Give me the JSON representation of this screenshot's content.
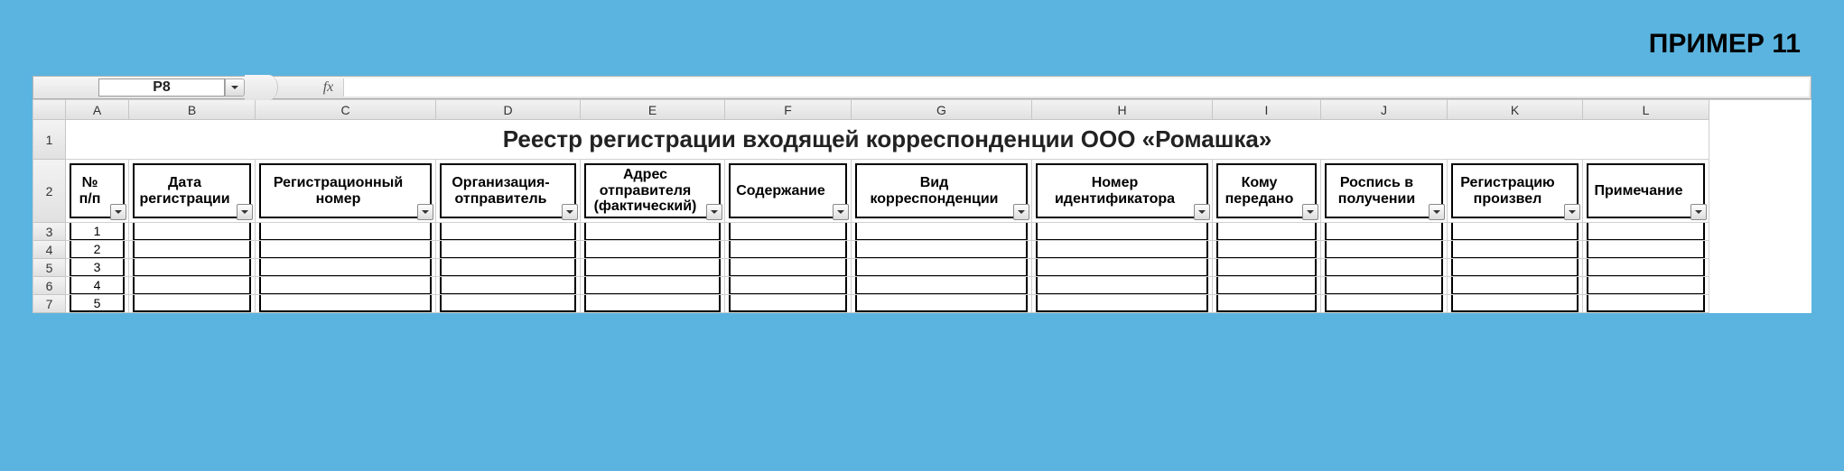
{
  "frame_label": "ПРИМЕР 11",
  "name_box": "P8",
  "fx_label": "fx",
  "formula_value": "",
  "columns": [
    "A",
    "B",
    "C",
    "D",
    "E",
    "F",
    "G",
    "H",
    "I",
    "J",
    "K",
    "L"
  ],
  "row_numbers": [
    "1",
    "2",
    "3",
    "4",
    "5",
    "6",
    "7"
  ],
  "title": "Реестр регистрации входящей корреспонденции ООО «Ромашка»",
  "headers": [
    "№ п/п",
    "Дата регистрации",
    "Регистрационный номер",
    "Организация-отправитель",
    "Адрес отправителя (фактический)",
    "Содержание",
    "Вид корреспонденции",
    "Номер идентификатора",
    "Кому передано",
    "Роспись в получении",
    "Регистрацию произвел",
    "Примечание"
  ],
  "data_rows": [
    {
      "n": "1",
      "cells": [
        "",
        "",
        "",
        "",
        "",
        "",
        "",
        "",
        "",
        "",
        "",
        ""
      ]
    },
    {
      "n": "2",
      "cells": [
        "",
        "",
        "",
        "",
        "",
        "",
        "",
        "",
        "",
        "",
        "",
        ""
      ]
    },
    {
      "n": "3",
      "cells": [
        "",
        "",
        "",
        "",
        "",
        "",
        "",
        "",
        "",
        "",
        "",
        ""
      ]
    },
    {
      "n": "4",
      "cells": [
        "",
        "",
        "",
        "",
        "",
        "",
        "",
        "",
        "",
        "",
        "",
        ""
      ]
    },
    {
      "n": "5",
      "cells": [
        "",
        "",
        "",
        "",
        "",
        "",
        "",
        "",
        "",
        "",
        "",
        ""
      ]
    }
  ]
}
